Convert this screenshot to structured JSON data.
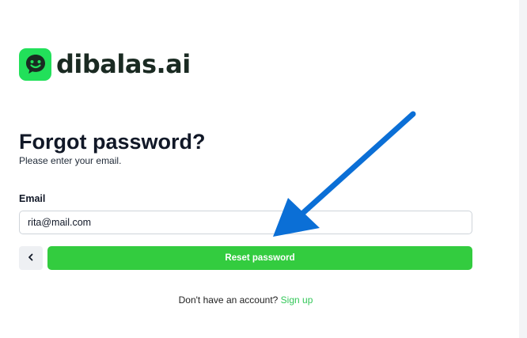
{
  "brand": {
    "name": "dibalas.ai",
    "logo_icon": "smiley-chat-icon",
    "accent_color": "#22e05a"
  },
  "form": {
    "title": "Forgot password?",
    "subtitle": "Please enter your email.",
    "email_label": "Email",
    "email_value": "rita@mail.com",
    "back_icon": "chevron-left-icon",
    "submit_label": "Reset password",
    "submit_color": "#33cc3f"
  },
  "footer": {
    "prompt": "Don't have an account?",
    "signup_link": "Sign up"
  },
  "annotation": {
    "arrow_color": "#0b6fd6",
    "arrow_icon": "arrow-pointer-icon"
  }
}
